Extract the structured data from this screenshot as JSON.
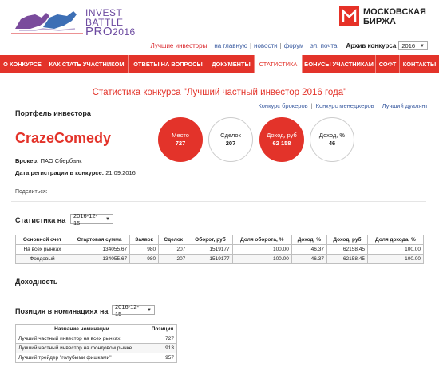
{
  "header": {
    "logo_line1": "INVEST",
    "logo_line2": "BATTLE",
    "logo_pro": "PRO",
    "logo_year": "2016",
    "exchange_name_line1": "МОСКОВСКАЯ",
    "exchange_name_line2": "БИРЖА",
    "best_investors_link": "Лучшие инвесторы",
    "links": [
      "на главную",
      "новости",
      "форум",
      "эл. почта"
    ],
    "archive_label": "Архив конкурса",
    "archive_year": "2016"
  },
  "nav": {
    "items": [
      "О КОНКУРСЕ",
      "КАК СТАТЬ УЧАСТНИКОМ",
      "ОТВЕТЫ НА ВОПРОСЫ",
      "ДОКУМЕНТЫ",
      "СТАТИСТИКА",
      "БОНУСЫ УЧАСТНИКАМ",
      "СОФТ",
      "КОНТАКТЫ"
    ],
    "active": "СТАТИСТИКА"
  },
  "page": {
    "title": "Статистика конкурса \"Лучший частный инвестор 2016 года\"",
    "sublinks": [
      "Конкурс брокеров",
      "Конкурс менеджеров",
      "Лучший дуалянт"
    ],
    "portfolio_heading": "Портфель инвестора",
    "trader_name": "CrazeComedy",
    "broker_label": "Брокер:",
    "broker_value": "ПАО Сбербанк",
    "reg_label": "Дата регистрации в конкурсе:",
    "reg_value": "21.09.2016",
    "share_label": "Поделиться:"
  },
  "stats_circles": [
    {
      "label": "Место",
      "value": "727",
      "style": "red"
    },
    {
      "label": "Сделок",
      "value": "207",
      "style": "white"
    },
    {
      "label": "Доход, руб",
      "value": "62 158",
      "style": "red"
    },
    {
      "label": "Доход, %",
      "value": "46",
      "style": "white"
    }
  ],
  "statistics": {
    "heading": "Статистика на",
    "date": "2016-12-15",
    "columns": [
      "Основной счет",
      "Стартовая сумма",
      "Заявок",
      "Сделок",
      "Оборот, руб",
      "Доля оборота, %",
      "Доход, %",
      "Доход, руб",
      "Доля дохода, %"
    ],
    "rows": [
      [
        "На всех рынках",
        "134055.67",
        "980",
        "207",
        "1519177",
        "100.00",
        "46.37",
        "62158.45",
        "100.00"
      ],
      [
        "Фондовый",
        "134055.67",
        "980",
        "207",
        "1519177",
        "100.00",
        "46.37",
        "62158.45",
        "100.00"
      ]
    ]
  },
  "income_heading": "Доходность",
  "nominations": {
    "heading": "Позиция в номинациях на",
    "date": "2016-12-15",
    "columns": [
      "Название номинации",
      "Позиция"
    ],
    "rows": [
      [
        "Лучший частный инвестор на всех рынках",
        "727"
      ],
      [
        "Лучший частный инвестор на фондовом рынке",
        "913"
      ],
      [
        "Лучший трейдер \"голубыми фишками\"",
        "957"
      ]
    ]
  },
  "colors": {
    "brand_red": "#e3332a",
    "logo_purple": "#6c4aa0",
    "link_blue": "#3a5ba0"
  }
}
